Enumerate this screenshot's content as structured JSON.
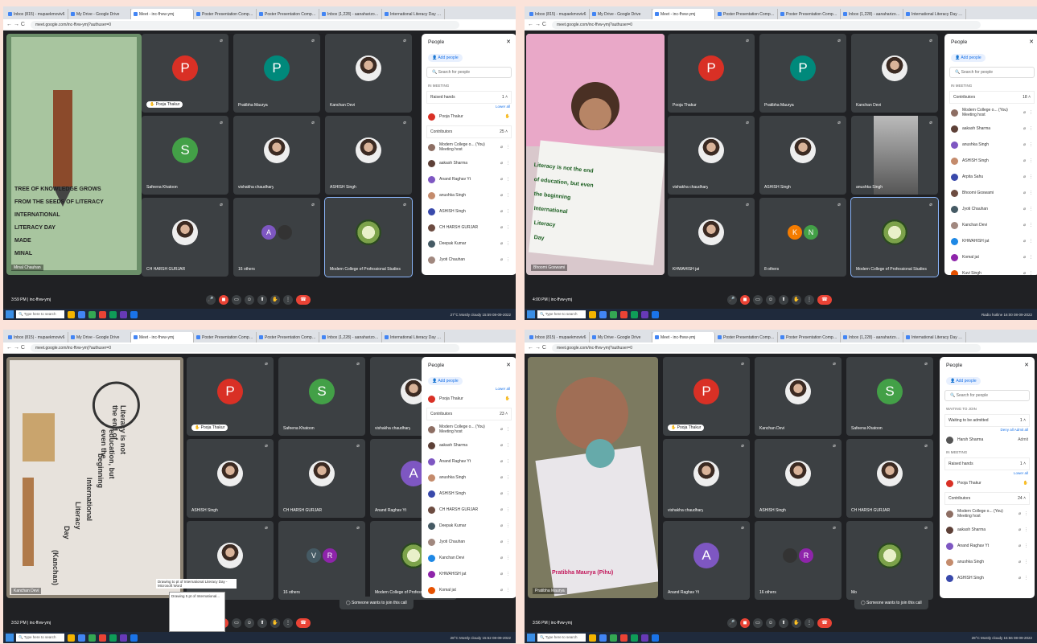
{
  "browser": {
    "tabs": [
      "Inbox (815) - mupaekmoviv6",
      "My Drive - Google Drive",
      "Meet - inc-fhvw-ymj",
      "Poster Presentation Competitio",
      "Poster Presentation Competitio",
      "Inbox (1,228) - aanaharizosaz",
      "International Literacy Day and"
    ],
    "url": "meet.google.com/inc-ffvw-ymj?authuser=0"
  },
  "meeting": {
    "code": "inc-ffvw-ymj"
  },
  "shots": [
    {
      "time": "3:59 PM",
      "presenter": "Minal Chauhan",
      "poster_text": [
        "TREE OF KNOWLEDGE GROWS",
        "FROM THE SEEDS OF LITERACY",
        "INTERNATIONAL",
        "LITERACY DAY",
        "MADE",
        "MINAL"
      ],
      "tiles": [
        {
          "name": "",
          "letter": "P",
          "color": "#d93025",
          "pin": "Pooja Thakur"
        },
        {
          "name": "Pratibha Maurya",
          "letter": "P",
          "color": "#00897b"
        },
        {
          "name": "Kanchan Devi",
          "photo": true
        },
        {
          "name": "Safeena Khatoon",
          "letter": "S",
          "color": "#43a047"
        },
        {
          "name": "vishakha chaudhary",
          "photo": true
        },
        {
          "name": "ASHISH Singh",
          "photo": true
        },
        {
          "name": "CH HARSH GURJAR",
          "photo": true
        },
        {
          "name": "16 others",
          "duo": [
            "A",
            ""
          ],
          "duocolors": [
            "#7e57c2",
            "#333"
          ]
        },
        {
          "name": "Modern College of Professional Studies",
          "logo": true,
          "hl": true
        }
      ],
      "panel": {
        "title": "People",
        "add": "Add people",
        "search": "Search for people",
        "in_meeting": "IN MEETING",
        "group": {
          "label": "Raised hands",
          "count": "1"
        },
        "lower_all": "Lower all",
        "raised": "Pooja Thakur",
        "contrib": {
          "label": "Contributors",
          "count": "25"
        },
        "people": [
          "Modern College o... (You)",
          "aakash Sharma",
          "Anand Raghav Yt",
          "anushka Singh",
          "ASHISH Singh",
          "CH HARSH GURJAR",
          "Deepak Kumar",
          "Jyoti Chauhan"
        ],
        "sub": "Meeting host"
      },
      "taskbar": {
        "search": "Type here to search",
        "tray": "27°C Mostly cloudy  15:59 08-09-2022"
      }
    },
    {
      "time": "4:00 PM",
      "presenter": "Bhoomi Goswami",
      "poster_text": [
        "Literacy is not the end",
        "of education, but even",
        "the beginning",
        "International",
        "Literacy",
        "Day"
      ],
      "tiles": [
        {
          "name": "Pooja Thakur",
          "letter": "P",
          "color": "#d93025"
        },
        {
          "name": "Pratibha Maurya",
          "letter": "P",
          "color": "#00897b"
        },
        {
          "name": "Kanchan Devi",
          "photo": true
        },
        {
          "name": "vishakha chaudhary",
          "photo": true
        },
        {
          "name": "ASHISH Singh",
          "photo": true
        },
        {
          "name": "anushka Singh",
          "cam": true
        },
        {
          "name": "KHWAHISH jat",
          "photo": true
        },
        {
          "name": "8 others",
          "duo": [
            "K",
            "N"
          ],
          "duocolors": [
            "#f57c00",
            "#43a047"
          ]
        },
        {
          "name": "Modern College of Professional Studies",
          "logo": true,
          "hl": true
        }
      ],
      "panel": {
        "title": "People",
        "add": "Add people",
        "search": "Search for people",
        "in_meeting": "IN MEETING",
        "contrib": {
          "label": "Contributors",
          "count": "18"
        },
        "people": [
          "Modern College o... (You)",
          "aakash Sharma",
          "anushka Singh",
          "ASHISH Singh",
          "Arpita Sahu",
          "Bhoomi Goswami",
          "Jyoti Chauhan",
          "Kanchan Devi",
          "KHWAHISH jat",
          "Komal jat",
          "Kuvi Singh"
        ],
        "sub": "Meeting host"
      },
      "taskbar": {
        "search": "Type here to search",
        "tray": "Radio hotline  16:00 08-09-2022"
      }
    },
    {
      "time": "3:52 PM",
      "presenter": "Kanchan Devi",
      "poster_text": [
        "Literacy is not the end of",
        "education, but even the",
        "beginning",
        "International",
        "Literacy",
        "Day",
        "(Kanchan)"
      ],
      "tiles": [
        {
          "name": "",
          "letter": "P",
          "color": "#d93025",
          "pin": "Pooja Thakur"
        },
        {
          "name": "Safeena Khatoon",
          "letter": "S",
          "color": "#43a047"
        },
        {
          "name": "vishakha chaudhary",
          "photo": true
        },
        {
          "name": "ASHISH Singh",
          "photo": true
        },
        {
          "name": "CH HARSH GURJAR",
          "photo": true
        },
        {
          "name": "Anand Raghav Yt",
          "letter": "A",
          "color": "#7e57c2"
        },
        {
          "name": "",
          "photo": true
        },
        {
          "name": "16 others",
          "duo": [
            "V",
            "R"
          ],
          "duocolors": [
            "#455a64",
            "#8e24aa"
          ]
        },
        {
          "name": "Modern College of Professional St...",
          "logo": true
        }
      ],
      "panel": {
        "title": "People",
        "add": "Add people",
        "lower_all": "Lower all",
        "raised": "Pooja Thakur",
        "contrib": {
          "label": "Contributors",
          "count": "23"
        },
        "people": [
          "Modern College o... (You)",
          "aakash Sharma",
          "Anand Raghav Yt",
          "anushka Singh",
          "ASHISH Singh",
          "CH HARSH GURJAR",
          "Deepak Kumar",
          "Jyoti Chauhan",
          "Kanchan Devi",
          "KHWAHISH jat",
          "Komal jat"
        ],
        "sub": "Meeting host"
      },
      "toast": "Someone wants to join this call",
      "thumb": [
        "Drawing to pt of International Literacy Day - Microsoft Word",
        "Drawing 5 pt of International..."
      ],
      "taskbar": {
        "search": "Type here to search",
        "tray": "28°C Mostly cloudy  15:52 08-09-2022"
      }
    },
    {
      "time": "3:56 PM",
      "presenter": "Pratibha Maurya",
      "poster_text": [
        "Pratibha Maurya (Pihu)"
      ],
      "tiles": [
        {
          "name": "",
          "letter": "P",
          "color": "#d93025",
          "pin": "Pooja Thakur"
        },
        {
          "name": "Kanchan Devi",
          "photo": true
        },
        {
          "name": "Safeena Khatoon",
          "letter": "S",
          "color": "#43a047"
        },
        {
          "name": "vishakha chaudhary",
          "photo": true
        },
        {
          "name": "ASHISH Singh",
          "photo": true
        },
        {
          "name": "CH HARSH GURJAR",
          "photo": true
        },
        {
          "name": "Anand Raghav Yt",
          "letter": "A",
          "color": "#7e57c2"
        },
        {
          "name": "16 others",
          "duo": [
            "",
            "R"
          ],
          "duocolors": [
            "#333",
            "#8e24aa"
          ]
        },
        {
          "name": "Mo",
          "logo": true
        }
      ],
      "panel": {
        "title": "People",
        "add": "Add people",
        "search": "Search for people",
        "waiting": "WAITING TO JOIN",
        "waitgroup": {
          "label": "Waiting to be admitted",
          "count": "1"
        },
        "deny": "Deny all",
        "admit_all": "Admit all",
        "waiter": "Harsh Sharma",
        "admit": "Admit",
        "in_meeting": "IN MEETING",
        "group": {
          "label": "Raised hands",
          "count": "1"
        },
        "lower_all": "Lower all",
        "raised": "Pooja Thakur",
        "contrib": {
          "label": "Contributors",
          "count": "24"
        },
        "people": [
          "Modern College o... (You)",
          "aakash Sharma",
          "Anand Raghav Yt",
          "anushka Singh",
          "ASHISH Singh"
        ],
        "sub": "Meeting host"
      },
      "toast": "Someone wants to join this call",
      "taskbar": {
        "search": "Type here to search",
        "tray": "28°C Mostly cloudy  15:56 08-09-2022"
      }
    }
  ]
}
